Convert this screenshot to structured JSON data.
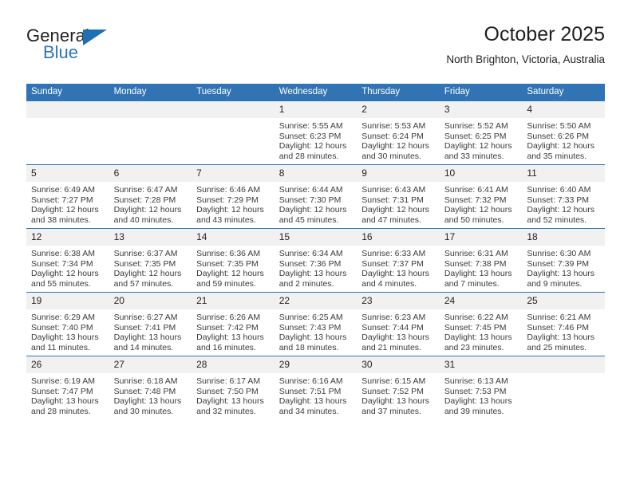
{
  "brand": {
    "name_part1": "General",
    "name_part2": "Blue",
    "triangle_color": "#1f6fb2",
    "blue_color": "#2e75b6"
  },
  "header": {
    "title": "October 2025",
    "subtitle": "North Brighton, Victoria, Australia"
  },
  "theme": {
    "header_blue": "#3174b5",
    "daynum_band": "#f1f1f1",
    "text": "#231f20",
    "detail_text": "#3b3b3b"
  },
  "weekday_headers": [
    "Sunday",
    "Monday",
    "Tuesday",
    "Wednesday",
    "Thursday",
    "Friday",
    "Saturday"
  ],
  "labels": {
    "sunrise_prefix": "Sunrise:",
    "sunset_prefix": "Sunset:",
    "daylight_prefix": "Daylight:"
  },
  "weeks": [
    [
      {
        "day": "",
        "empty": true,
        "sunrise": "",
        "sunset": "",
        "daylight_line1": "",
        "daylight_line2": ""
      },
      {
        "day": "",
        "empty": true,
        "sunrise": "",
        "sunset": "",
        "daylight_line1": "",
        "daylight_line2": ""
      },
      {
        "day": "",
        "empty": true,
        "sunrise": "",
        "sunset": "",
        "daylight_line1": "",
        "daylight_line2": ""
      },
      {
        "day": "1",
        "empty": false,
        "sunrise": "Sunrise: 5:55 AM",
        "sunset": "Sunset: 6:23 PM",
        "daylight_line1": "Daylight: 12 hours",
        "daylight_line2": "and 28 minutes."
      },
      {
        "day": "2",
        "empty": false,
        "sunrise": "Sunrise: 5:53 AM",
        "sunset": "Sunset: 6:24 PM",
        "daylight_line1": "Daylight: 12 hours",
        "daylight_line2": "and 30 minutes."
      },
      {
        "day": "3",
        "empty": false,
        "sunrise": "Sunrise: 5:52 AM",
        "sunset": "Sunset: 6:25 PM",
        "daylight_line1": "Daylight: 12 hours",
        "daylight_line2": "and 33 minutes."
      },
      {
        "day": "4",
        "empty": false,
        "sunrise": "Sunrise: 5:50 AM",
        "sunset": "Sunset: 6:26 PM",
        "daylight_line1": "Daylight: 12 hours",
        "daylight_line2": "and 35 minutes."
      }
    ],
    [
      {
        "day": "5",
        "empty": false,
        "sunrise": "Sunrise: 6:49 AM",
        "sunset": "Sunset: 7:27 PM",
        "daylight_line1": "Daylight: 12 hours",
        "daylight_line2": "and 38 minutes."
      },
      {
        "day": "6",
        "empty": false,
        "sunrise": "Sunrise: 6:47 AM",
        "sunset": "Sunset: 7:28 PM",
        "daylight_line1": "Daylight: 12 hours",
        "daylight_line2": "and 40 minutes."
      },
      {
        "day": "7",
        "empty": false,
        "sunrise": "Sunrise: 6:46 AM",
        "sunset": "Sunset: 7:29 PM",
        "daylight_line1": "Daylight: 12 hours",
        "daylight_line2": "and 43 minutes."
      },
      {
        "day": "8",
        "empty": false,
        "sunrise": "Sunrise: 6:44 AM",
        "sunset": "Sunset: 7:30 PM",
        "daylight_line1": "Daylight: 12 hours",
        "daylight_line2": "and 45 minutes."
      },
      {
        "day": "9",
        "empty": false,
        "sunrise": "Sunrise: 6:43 AM",
        "sunset": "Sunset: 7:31 PM",
        "daylight_line1": "Daylight: 12 hours",
        "daylight_line2": "and 47 minutes."
      },
      {
        "day": "10",
        "empty": false,
        "sunrise": "Sunrise: 6:41 AM",
        "sunset": "Sunset: 7:32 PM",
        "daylight_line1": "Daylight: 12 hours",
        "daylight_line2": "and 50 minutes."
      },
      {
        "day": "11",
        "empty": false,
        "sunrise": "Sunrise: 6:40 AM",
        "sunset": "Sunset: 7:33 PM",
        "daylight_line1": "Daylight: 12 hours",
        "daylight_line2": "and 52 minutes."
      }
    ],
    [
      {
        "day": "12",
        "empty": false,
        "sunrise": "Sunrise: 6:38 AM",
        "sunset": "Sunset: 7:34 PM",
        "daylight_line1": "Daylight: 12 hours",
        "daylight_line2": "and 55 minutes."
      },
      {
        "day": "13",
        "empty": false,
        "sunrise": "Sunrise: 6:37 AM",
        "sunset": "Sunset: 7:35 PM",
        "daylight_line1": "Daylight: 12 hours",
        "daylight_line2": "and 57 minutes."
      },
      {
        "day": "14",
        "empty": false,
        "sunrise": "Sunrise: 6:36 AM",
        "sunset": "Sunset: 7:35 PM",
        "daylight_line1": "Daylight: 12 hours",
        "daylight_line2": "and 59 minutes."
      },
      {
        "day": "15",
        "empty": false,
        "sunrise": "Sunrise: 6:34 AM",
        "sunset": "Sunset: 7:36 PM",
        "daylight_line1": "Daylight: 13 hours",
        "daylight_line2": "and 2 minutes."
      },
      {
        "day": "16",
        "empty": false,
        "sunrise": "Sunrise: 6:33 AM",
        "sunset": "Sunset: 7:37 PM",
        "daylight_line1": "Daylight: 13 hours",
        "daylight_line2": "and 4 minutes."
      },
      {
        "day": "17",
        "empty": false,
        "sunrise": "Sunrise: 6:31 AM",
        "sunset": "Sunset: 7:38 PM",
        "daylight_line1": "Daylight: 13 hours",
        "daylight_line2": "and 7 minutes."
      },
      {
        "day": "18",
        "empty": false,
        "sunrise": "Sunrise: 6:30 AM",
        "sunset": "Sunset: 7:39 PM",
        "daylight_line1": "Daylight: 13 hours",
        "daylight_line2": "and 9 minutes."
      }
    ],
    [
      {
        "day": "19",
        "empty": false,
        "sunrise": "Sunrise: 6:29 AM",
        "sunset": "Sunset: 7:40 PM",
        "daylight_line1": "Daylight: 13 hours",
        "daylight_line2": "and 11 minutes."
      },
      {
        "day": "20",
        "empty": false,
        "sunrise": "Sunrise: 6:27 AM",
        "sunset": "Sunset: 7:41 PM",
        "daylight_line1": "Daylight: 13 hours",
        "daylight_line2": "and 14 minutes."
      },
      {
        "day": "21",
        "empty": false,
        "sunrise": "Sunrise: 6:26 AM",
        "sunset": "Sunset: 7:42 PM",
        "daylight_line1": "Daylight: 13 hours",
        "daylight_line2": "and 16 minutes."
      },
      {
        "day": "22",
        "empty": false,
        "sunrise": "Sunrise: 6:25 AM",
        "sunset": "Sunset: 7:43 PM",
        "daylight_line1": "Daylight: 13 hours",
        "daylight_line2": "and 18 minutes."
      },
      {
        "day": "23",
        "empty": false,
        "sunrise": "Sunrise: 6:23 AM",
        "sunset": "Sunset: 7:44 PM",
        "daylight_line1": "Daylight: 13 hours",
        "daylight_line2": "and 21 minutes."
      },
      {
        "day": "24",
        "empty": false,
        "sunrise": "Sunrise: 6:22 AM",
        "sunset": "Sunset: 7:45 PM",
        "daylight_line1": "Daylight: 13 hours",
        "daylight_line2": "and 23 minutes."
      },
      {
        "day": "25",
        "empty": false,
        "sunrise": "Sunrise: 6:21 AM",
        "sunset": "Sunset: 7:46 PM",
        "daylight_line1": "Daylight: 13 hours",
        "daylight_line2": "and 25 minutes."
      }
    ],
    [
      {
        "day": "26",
        "empty": false,
        "sunrise": "Sunrise: 6:19 AM",
        "sunset": "Sunset: 7:47 PM",
        "daylight_line1": "Daylight: 13 hours",
        "daylight_line2": "and 28 minutes."
      },
      {
        "day": "27",
        "empty": false,
        "sunrise": "Sunrise: 6:18 AM",
        "sunset": "Sunset: 7:48 PM",
        "daylight_line1": "Daylight: 13 hours",
        "daylight_line2": "and 30 minutes."
      },
      {
        "day": "28",
        "empty": false,
        "sunrise": "Sunrise: 6:17 AM",
        "sunset": "Sunset: 7:50 PM",
        "daylight_line1": "Daylight: 13 hours",
        "daylight_line2": "and 32 minutes."
      },
      {
        "day": "29",
        "empty": false,
        "sunrise": "Sunrise: 6:16 AM",
        "sunset": "Sunset: 7:51 PM",
        "daylight_line1": "Daylight: 13 hours",
        "daylight_line2": "and 34 minutes."
      },
      {
        "day": "30",
        "empty": false,
        "sunrise": "Sunrise: 6:15 AM",
        "sunset": "Sunset: 7:52 PM",
        "daylight_line1": "Daylight: 13 hours",
        "daylight_line2": "and 37 minutes."
      },
      {
        "day": "31",
        "empty": false,
        "sunrise": "Sunrise: 6:13 AM",
        "sunset": "Sunset: 7:53 PM",
        "daylight_line1": "Daylight: 13 hours",
        "daylight_line2": "and 39 minutes."
      },
      {
        "day": "",
        "empty": true,
        "sunrise": "",
        "sunset": "",
        "daylight_line1": "",
        "daylight_line2": ""
      }
    ]
  ]
}
